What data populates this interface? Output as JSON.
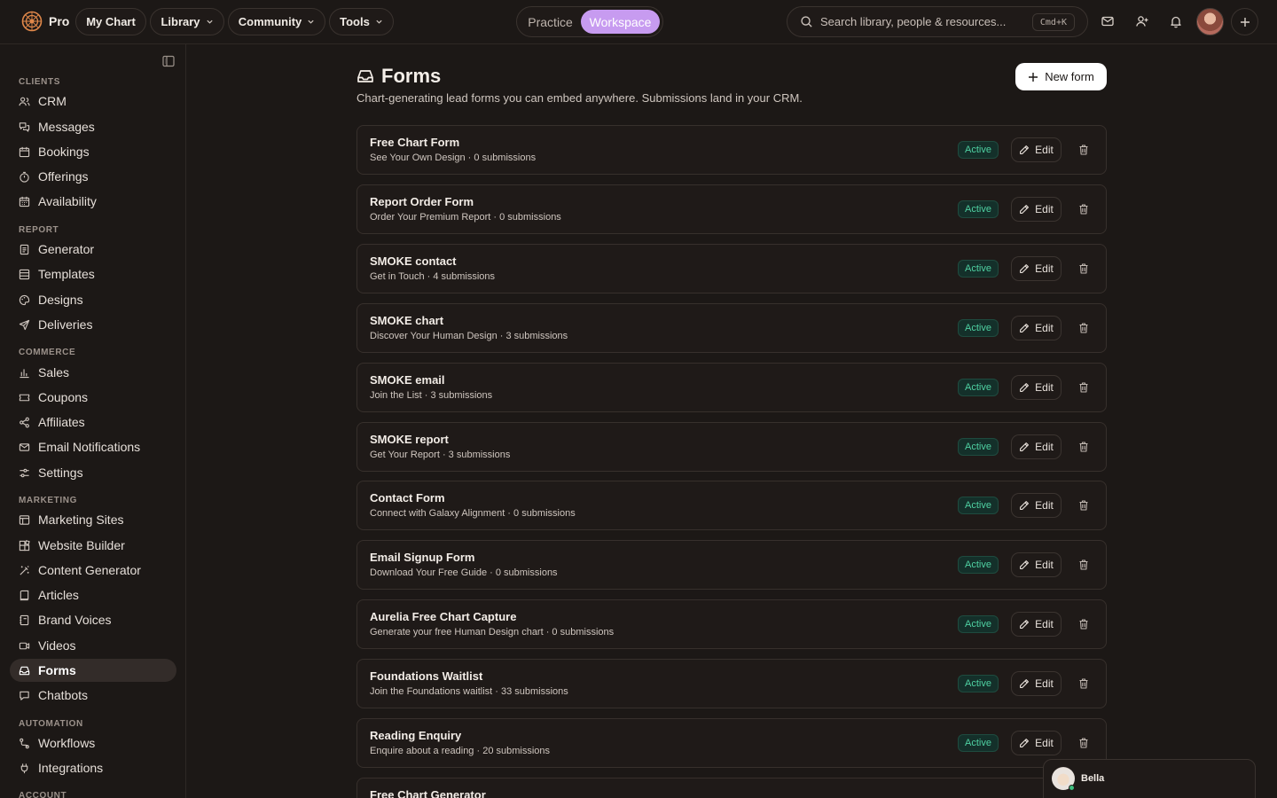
{
  "topbar": {
    "brand": "Pro",
    "nav": [
      {
        "label": "My Chart",
        "dropdown": false
      },
      {
        "label": "Library",
        "dropdown": true
      },
      {
        "label": "Community",
        "dropdown": true
      },
      {
        "label": "Tools",
        "dropdown": true
      }
    ],
    "mode": {
      "practice": "Practice",
      "workspace": "Workspace",
      "selected": "Workspace"
    },
    "search": {
      "placeholder": "Search library, people & resources...",
      "shortcut": "Cmd+K"
    },
    "icons": [
      "mail-icon",
      "add-person-icon",
      "bell-icon",
      "avatar",
      "plus-icon"
    ]
  },
  "sidebar": {
    "sections": [
      {
        "title": "CLIENTS",
        "items": [
          {
            "label": "CRM",
            "icon": "users-icon"
          },
          {
            "label": "Messages",
            "icon": "messages-icon"
          },
          {
            "label": "Bookings",
            "icon": "calendar-icon"
          },
          {
            "label": "Offerings",
            "icon": "timer-icon"
          },
          {
            "label": "Availability",
            "icon": "calendar-grid-icon"
          }
        ]
      },
      {
        "title": "REPORT",
        "items": [
          {
            "label": "Generator",
            "icon": "document-icon"
          },
          {
            "label": "Templates",
            "icon": "layout-icon"
          },
          {
            "label": "Designs",
            "icon": "palette-icon"
          },
          {
            "label": "Deliveries",
            "icon": "send-icon"
          }
        ]
      },
      {
        "title": "COMMERCE",
        "items": [
          {
            "label": "Sales",
            "icon": "bar-chart-icon"
          },
          {
            "label": "Coupons",
            "icon": "ticket-icon"
          },
          {
            "label": "Affiliates",
            "icon": "share-icon"
          },
          {
            "label": "Email Notifications",
            "icon": "mail-icon"
          },
          {
            "label": "Settings",
            "icon": "sliders-icon"
          }
        ]
      },
      {
        "title": "MARKETING",
        "items": [
          {
            "label": "Marketing Sites",
            "icon": "browser-icon"
          },
          {
            "label": "Website Builder",
            "icon": "blocks-icon"
          },
          {
            "label": "Content Generator",
            "icon": "wand-icon"
          },
          {
            "label": "Articles",
            "icon": "book-icon"
          },
          {
            "label": "Brand Voices",
            "icon": "notebook-icon"
          },
          {
            "label": "Videos",
            "icon": "video-icon"
          },
          {
            "label": "Forms",
            "icon": "inbox-icon",
            "active": true
          },
          {
            "label": "Chatbots",
            "icon": "chat-icon"
          }
        ]
      },
      {
        "title": "AUTOMATION",
        "items": [
          {
            "label": "Workflows",
            "icon": "workflow-icon"
          },
          {
            "label": "Integrations",
            "icon": "plug-icon"
          }
        ]
      },
      {
        "title": "ACCOUNT",
        "items": []
      }
    ]
  },
  "main": {
    "title": "Forms",
    "subtitle": "Chart-generating lead forms you can embed anywhere. Submissions land in your CRM.",
    "new_button": "New form",
    "forms": [
      {
        "title": "Free Chart Form",
        "subtitle": "See Your Own Design · 0 submissions",
        "status": "Active",
        "edit": "Edit"
      },
      {
        "title": "Report Order Form",
        "subtitle": "Order Your Premium Report · 0 submissions",
        "status": "Active",
        "edit": "Edit"
      },
      {
        "title": "SMOKE contact",
        "subtitle": "Get in Touch · 4 submissions",
        "status": "Active",
        "edit": "Edit"
      },
      {
        "title": "SMOKE chart",
        "subtitle": "Discover Your Human Design · 3 submissions",
        "status": "Active",
        "edit": "Edit"
      },
      {
        "title": "SMOKE email",
        "subtitle": "Join the List · 3 submissions",
        "status": "Active",
        "edit": "Edit"
      },
      {
        "title": "SMOKE report",
        "subtitle": "Get Your Report · 3 submissions",
        "status": "Active",
        "edit": "Edit"
      },
      {
        "title": "Contact Form",
        "subtitle": "Connect with Galaxy Alignment · 0 submissions",
        "status": "Active",
        "edit": "Edit"
      },
      {
        "title": "Email Signup Form",
        "subtitle": "Download Your Free Guide · 0 submissions",
        "status": "Active",
        "edit": "Edit"
      },
      {
        "title": "Aurelia Free Chart Capture",
        "subtitle": "Generate your free Human Design chart · 0 submissions",
        "status": "Active",
        "edit": "Edit"
      },
      {
        "title": "Foundations Waitlist",
        "subtitle": "Join the Foundations waitlist · 33 submissions",
        "status": "Active",
        "edit": "Edit"
      },
      {
        "title": "Reading Enquiry",
        "subtitle": "Enquire about a reading · 20 submissions",
        "status": "Active",
        "edit": "Edit"
      },
      {
        "title": "Free Chart Generator",
        "subtitle": "",
        "status": "",
        "edit": ""
      }
    ]
  },
  "chat_widget": {
    "name": "Bella"
  },
  "colors": {
    "accent": "#c79bf0",
    "status_active": "#4fd1a2",
    "background": "#1c1816"
  }
}
